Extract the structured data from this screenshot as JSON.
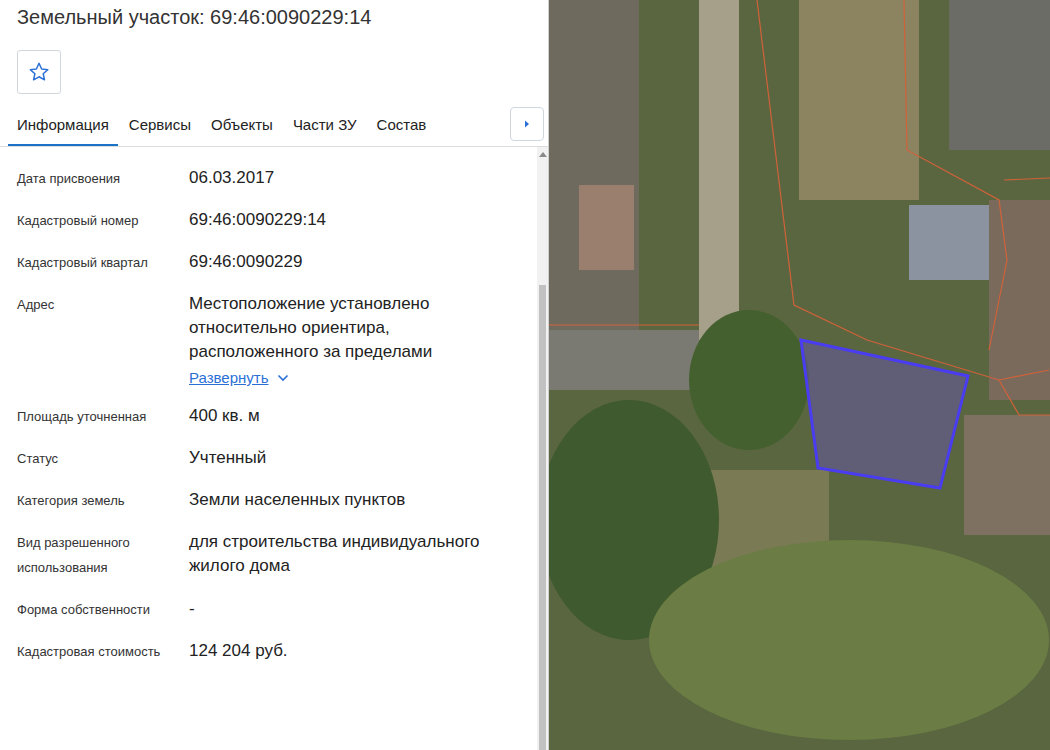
{
  "title": "Земельный участок: 69:46:0090229:14",
  "favorite": {
    "selected": false
  },
  "tabs": [
    {
      "label": "Информация",
      "selected": true
    },
    {
      "label": "Сервисы",
      "selected": false
    },
    {
      "label": "Объекты",
      "selected": false
    },
    {
      "label": "Части ЗУ",
      "selected": false
    },
    {
      "label": "Состав",
      "selected": false
    }
  ],
  "fields": [
    {
      "kind": "text",
      "label": "Дата присвоения",
      "value": "06.03.2017"
    },
    {
      "kind": "text",
      "label": "Кадастровый номер",
      "value": "69:46:0090229:14"
    },
    {
      "kind": "text",
      "label": "Кадастровый квартал",
      "value": "69:46:0090229"
    },
    {
      "kind": "address",
      "label": "Адрес",
      "value": "Местоположение установлено относительно ориентира, расположенного за пределами",
      "expand": "Развернуть",
      "expanded": false
    },
    {
      "kind": "text",
      "label": "Площадь уточненная",
      "value": "400 кв. м"
    },
    {
      "kind": "text",
      "label": "Статус",
      "value": "Учтенный"
    },
    {
      "kind": "text",
      "label": "Категория земель",
      "value": "Земли населенных пунктов"
    },
    {
      "kind": "text",
      "label": "Вид разрешенного использования",
      "value": "для строительства индивидуального жилого дома"
    },
    {
      "kind": "text",
      "label": "Форма собственности",
      "value": "-"
    },
    {
      "kind": "text",
      "label": "Кадастровая стоимость",
      "value": "124 204 руб."
    }
  ],
  "scrollbar": {
    "position": 0.21,
    "level": 0.79
  }
}
